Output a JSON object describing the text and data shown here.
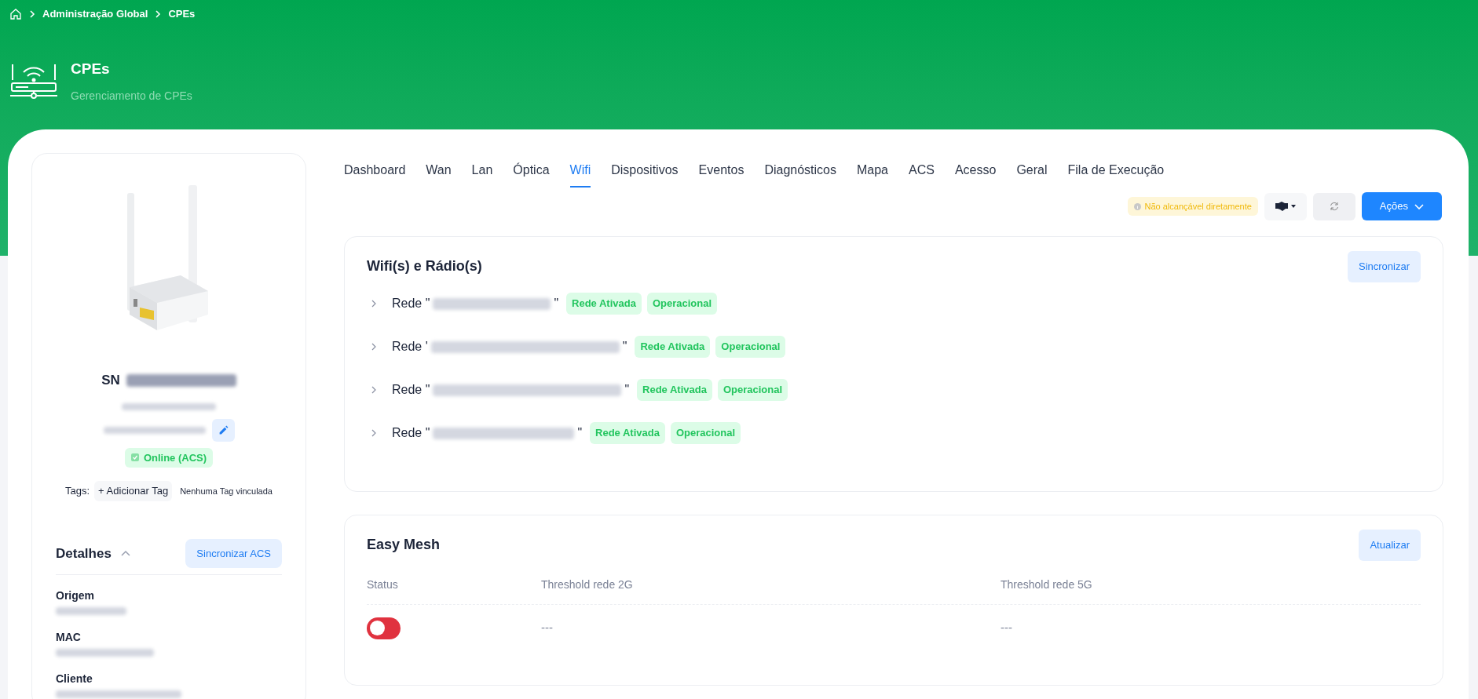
{
  "breadcrumb": [
    {
      "label": "Administração Global"
    },
    {
      "label": "CPEs"
    }
  ],
  "header": {
    "title": "CPEs",
    "subtitle": "Gerenciamento de CPEs"
  },
  "device": {
    "sn_label": "SN",
    "status": "Online (ACS)",
    "tags_label": "Tags:",
    "add_tag": "+ Adicionar Tag",
    "no_tags": "Nenhuma Tag vinculada"
  },
  "details": {
    "title": "Detalhes",
    "expanded": true,
    "sync_button": "Sincronizar ACS",
    "fields": [
      {
        "label": "Origem"
      },
      {
        "label": "MAC"
      },
      {
        "label": "Cliente"
      }
    ]
  },
  "tabs": [
    {
      "label": "Dashboard",
      "selected": false
    },
    {
      "label": "Wan",
      "selected": false
    },
    {
      "label": "Lan",
      "selected": false
    },
    {
      "label": "Óptica",
      "selected": false
    },
    {
      "label": "Wifi",
      "selected": true
    },
    {
      "label": "Dispositivos",
      "selected": false
    },
    {
      "label": "Eventos",
      "selected": false
    },
    {
      "label": "Diagnósticos",
      "selected": false
    },
    {
      "label": "Mapa",
      "selected": false
    },
    {
      "label": "ACS",
      "selected": false
    },
    {
      "label": "Acesso",
      "selected": false
    },
    {
      "label": "Geral",
      "selected": false
    },
    {
      "label": "Fila de Execução",
      "selected": false
    }
  ],
  "toolbar": {
    "reachability": "Não alcançável diretamente",
    "actions": "Ações"
  },
  "wifi_card": {
    "title": "Wifi(s) e Rádio(s)",
    "sync_button": "Sincronizar",
    "networks": [
      {
        "label": "Rede \"",
        "close": "\"",
        "expanded": false,
        "badges": [
          "Rede Ativada",
          "Operacional"
        ]
      },
      {
        "label": "Rede '",
        "close": "\"",
        "expanded": false,
        "badges": [
          "Rede Ativada",
          "Operacional"
        ]
      },
      {
        "label": "Rede \"",
        "close": "\"",
        "expanded": false,
        "badges": [
          "Rede Ativada",
          "Operacional"
        ]
      },
      {
        "label": "Rede \"",
        "close": "\"",
        "expanded": false,
        "badges": [
          "Rede Ativada",
          "Operacional"
        ]
      }
    ]
  },
  "easy_mesh": {
    "title": "Easy Mesh",
    "update_button": "Atualizar",
    "columns": [
      "Status",
      "Threshold rede 2G",
      "Threshold rede 5G"
    ],
    "rows": [
      {
        "on": false,
        "threshold_2g": "---",
        "threshold_5g": "---"
      }
    ]
  }
}
